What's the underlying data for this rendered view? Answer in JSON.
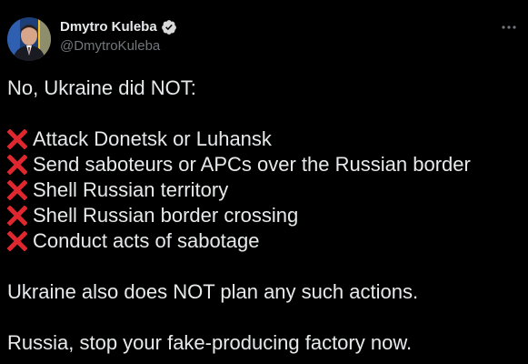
{
  "author": {
    "display_name": "Dmytro Kuleba",
    "handle": "@DmytroKuleba",
    "verified_icon": "verified-badge-icon",
    "avatar_icon": "avatar-photo"
  },
  "menu": {
    "icon": "more-horizontal-icon"
  },
  "tweet": {
    "intro": "No, Ukraine did NOT:",
    "items": [
      "Attack Donetsk or Luhansk",
      "Send saboteurs or APCs over the Russian border",
      "Shell Russian territory",
      "Shell Russian border crossing",
      "Conduct acts of sabotage"
    ],
    "item_icon": "cross-mark-icon",
    "statement": "Ukraine also does NOT plan any such actions.",
    "closing": "Russia, stop your fake-producing factory now."
  },
  "colors": {
    "background": "#000000",
    "text": "#e7e9ea",
    "secondary_text": "#71767b",
    "cross_mark": "#e0262e",
    "verified": "#d9d9d9"
  }
}
